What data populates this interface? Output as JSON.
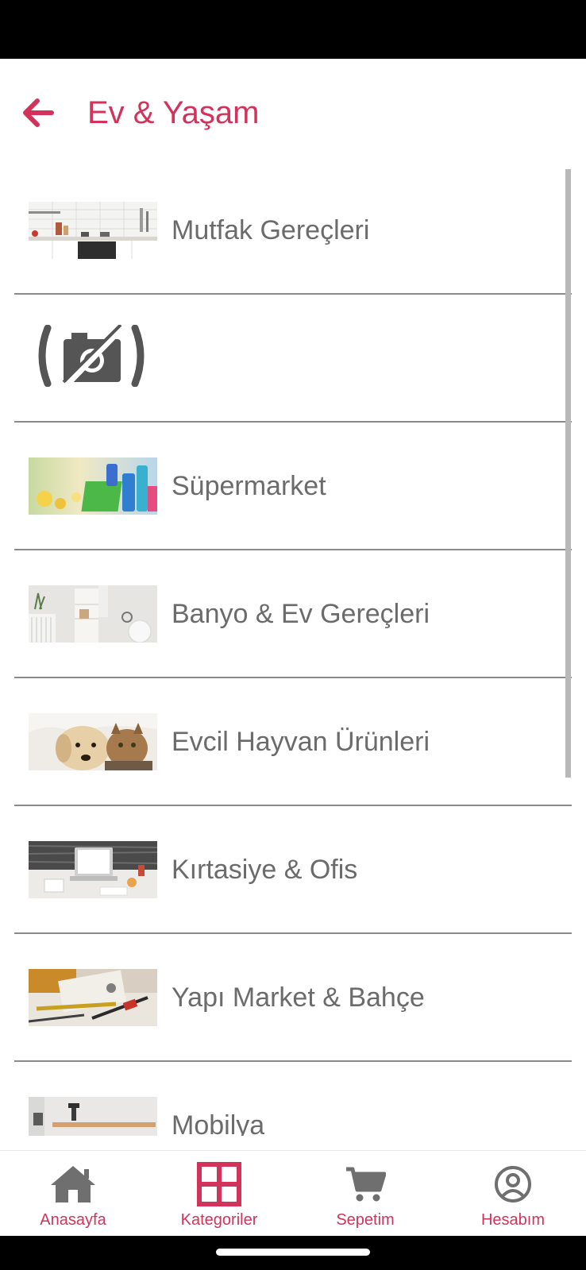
{
  "header": {
    "title": "Ev & Yaşam",
    "back_icon": "arrow-left-icon"
  },
  "colors": {
    "accent": "#d3335a",
    "text": "#6b6b6b",
    "divider": "#8a8a8a",
    "icon_gray": "#6f6f6f"
  },
  "categories": [
    {
      "label": "Mutfak Gereçleri",
      "image": "kitchen-image"
    },
    {
      "label": "",
      "image": "no-image-camera-icon"
    },
    {
      "label": "Süpermarket",
      "image": "cleaning-supplies-image"
    },
    {
      "label": "Banyo & Ev Gereçleri",
      "image": "bathroom-image"
    },
    {
      "label": "Evcil Hayvan Ürünleri",
      "image": "pets-image"
    },
    {
      "label": "Kırtasiye & Ofis",
      "image": "office-desk-image"
    },
    {
      "label": "Yapı Market & Bahçe",
      "image": "tools-image"
    },
    {
      "label": "Mobilya",
      "image": "furniture-image"
    }
  ],
  "tabbar": {
    "items": [
      {
        "label": "Anasayfa",
        "icon": "home-icon"
      },
      {
        "label": "Kategoriler",
        "icon": "grid-icon",
        "active": true
      },
      {
        "label": "Sepetim",
        "icon": "cart-icon"
      },
      {
        "label": "Hesabım",
        "icon": "account-icon"
      }
    ]
  }
}
